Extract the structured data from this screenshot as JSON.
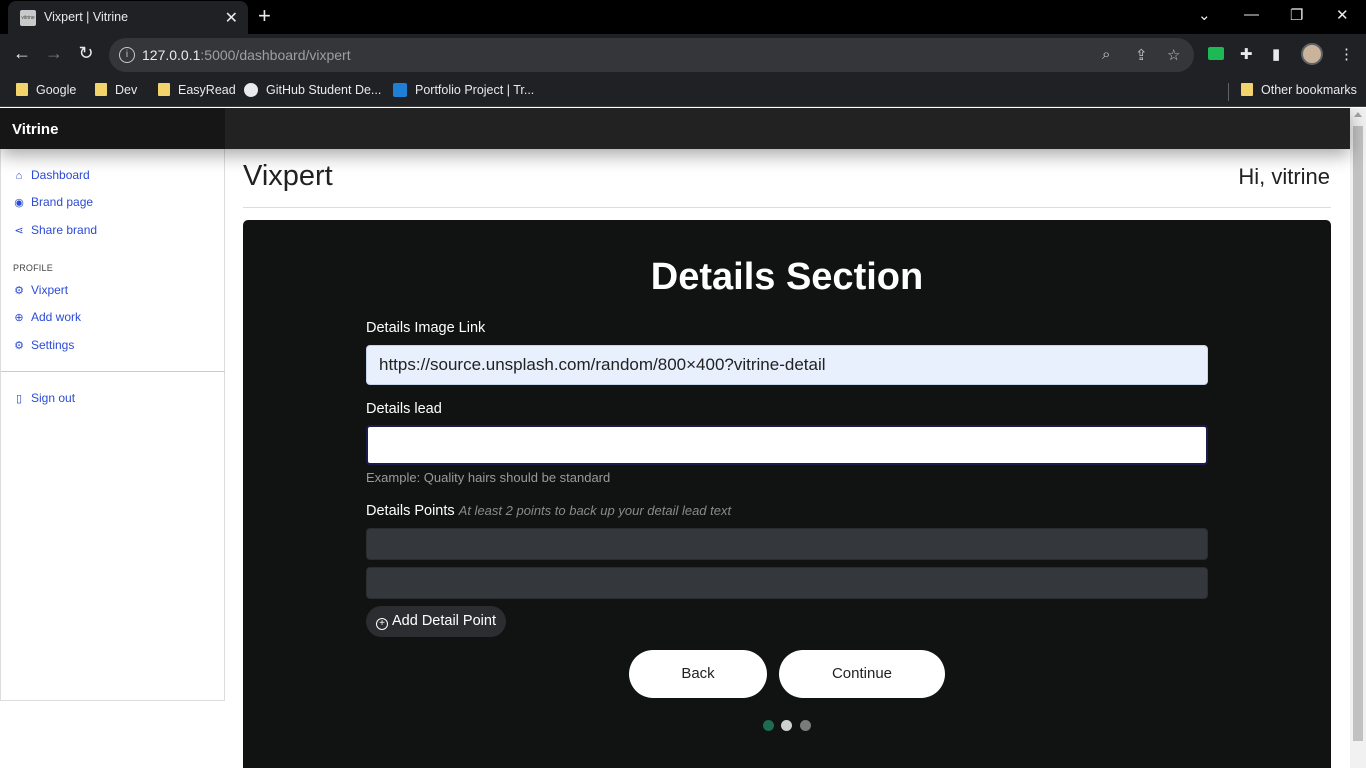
{
  "browser": {
    "tab_title": "Vixpert | Vitrine",
    "favicon_text": "vitrine",
    "url_host": "127.0.0.1",
    "url_path": ":5000/dashboard/vixpert",
    "bookmarks": [
      "Google",
      "Dev",
      "EasyRead",
      "GitHub Student De...",
      "Portfolio Project | Tr..."
    ],
    "other_bookmarks": "Other bookmarks"
  },
  "app": {
    "brand": "Vitrine"
  },
  "sidebar": {
    "items": [
      {
        "label": "Dashboard",
        "icon": "home-icon"
      },
      {
        "label": "Brand page",
        "icon": "eye-icon"
      },
      {
        "label": "Share brand",
        "icon": "share-icon"
      }
    ],
    "profile_heading": "PROFILE",
    "profile_items": [
      {
        "label": "Vixpert",
        "icon": "brand-icon"
      },
      {
        "label": "Add work",
        "icon": "plus-circle-icon"
      },
      {
        "label": "Settings",
        "icon": "gear-icon"
      }
    ],
    "signout": {
      "label": "Sign out",
      "icon": "door-icon"
    }
  },
  "header": {
    "title": "Vixpert",
    "greeting": "Hi, vitrine"
  },
  "form": {
    "section_title": "Details Section",
    "image_link_label": "Details Image Link",
    "image_link_value": "https://source.unsplash.com/random/800×400?vitrine-detail",
    "lead_label": "Details lead",
    "lead_value": "",
    "lead_help": "Example: Quality hairs should be standard",
    "points_label": "Details Points",
    "points_hint": "At least 2 points to back up your detail lead text",
    "add_point_label": "Add Detail Point",
    "back_label": "Back",
    "continue_label": "Continue",
    "steps": {
      "current": 1,
      "total": 3
    }
  },
  "colors": {
    "accent_link": "#2c4bd6",
    "panel_bg": "#111212",
    "step_active": "#1e6b4f"
  }
}
